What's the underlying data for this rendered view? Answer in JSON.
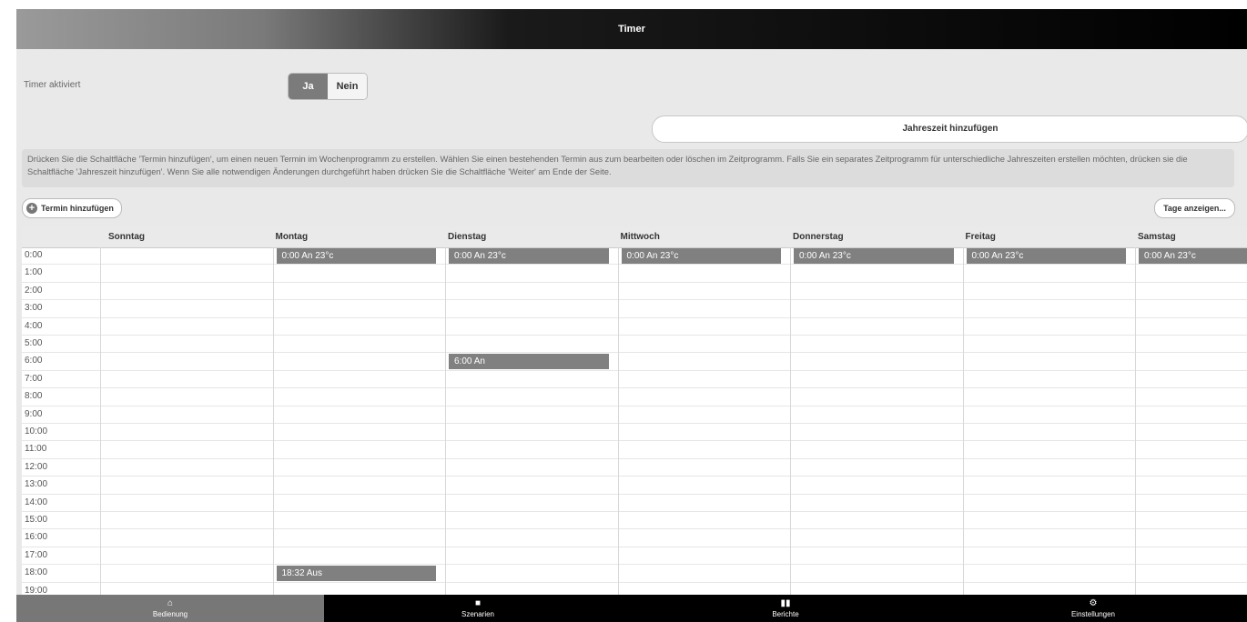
{
  "header": {
    "title": "Timer"
  },
  "timer_toggle": {
    "label": "Timer aktiviert",
    "yes": "Ja",
    "no": "Nein",
    "selected": "Ja"
  },
  "season_button": "Jahreszeit hinzufügen",
  "info_text": "Drücken Sie die Schaltfläche 'Termin hinzufügen', um einen neuen Termin im Wochenprogramm zu erstellen. Wählen Sie einen bestehenden Termin aus zum bearbeiten oder löschen im Zeitprogramm. Falls Sie ein separates Zeitprogramm für unterschiedliche Jahreszeiten erstellen möchten, drücken sie die Schaltfläche 'Jahreszeit hinzufügen'. Wenn Sie alle notwendigen Änderungen durchgeführt haben drücken Sie die Schaltfläche 'Weiter' am Ende der Seite.",
  "add_button": "Termin hinzufügen",
  "days_button": "Tage anzeigen...",
  "days": [
    "Sonntag",
    "Montag",
    "Dienstag",
    "Mittwoch",
    "Donnerstag",
    "Freitag",
    "Samstag"
  ],
  "hours": [
    "0:00",
    "1:00",
    "2:00",
    "3:00",
    "4:00",
    "5:00",
    "6:00",
    "7:00",
    "8:00",
    "9:00",
    "10:00",
    "11:00",
    "12:00",
    "13:00",
    "14:00",
    "15:00",
    "16:00",
    "17:00",
    "18:00",
    "19:00"
  ],
  "events": [
    {
      "day": 1,
      "hour": 0,
      "label": "0:00 An 23°c"
    },
    {
      "day": 2,
      "hour": 0,
      "label": "0:00 An 23°c"
    },
    {
      "day": 3,
      "hour": 0,
      "label": "0:00 An 23°c"
    },
    {
      "day": 4,
      "hour": 0,
      "label": "0:00 An 23°c"
    },
    {
      "day": 5,
      "hour": 0,
      "label": "0:00 An 23°c"
    },
    {
      "day": 6,
      "hour": 0,
      "label": "0:00 An 23°c"
    },
    {
      "day": 2,
      "hour": 6,
      "label": "6:00 An"
    },
    {
      "day": 1,
      "hour": 18,
      "label": "18:32 Aus"
    }
  ],
  "tabs": [
    {
      "label": "Bedienung",
      "icon": "home-icon",
      "glyph": "⌂",
      "active": true
    },
    {
      "label": "Szenarien",
      "icon": "camera-icon",
      "glyph": "■",
      "active": false
    },
    {
      "label": "Berichte",
      "icon": "report-icon",
      "glyph": "▮▮",
      "active": false
    },
    {
      "label": "Einstellungen",
      "icon": "gear-icon",
      "glyph": "⚙",
      "active": false
    }
  ]
}
